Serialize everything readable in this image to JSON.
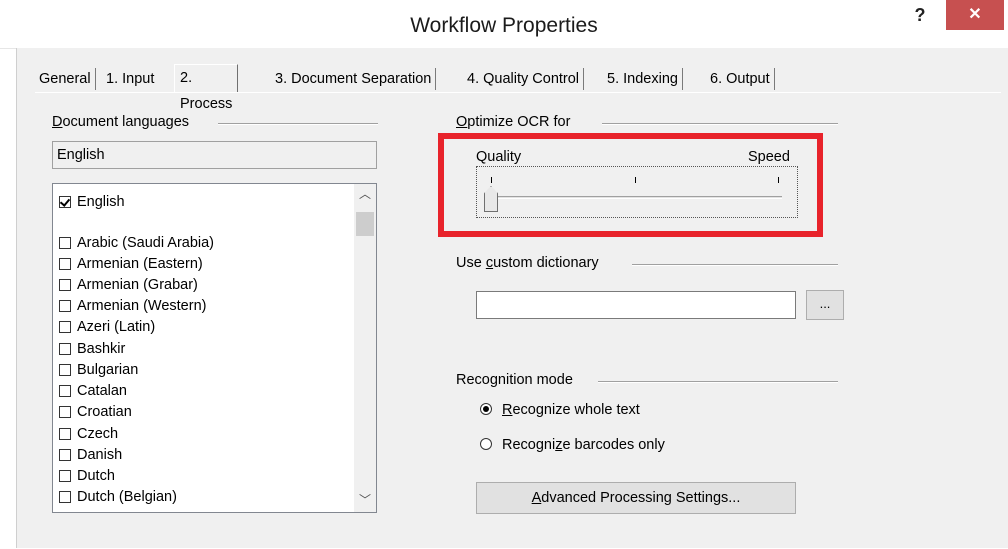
{
  "window": {
    "title": "Workflow Properties",
    "help_label": "?",
    "close_label": "✕"
  },
  "tabs": [
    {
      "label": "General"
    },
    {
      "label": "1. Input"
    },
    {
      "label": "2. Process",
      "active": true
    },
    {
      "label": "3. Document Separation"
    },
    {
      "label": "4. Quality Control"
    },
    {
      "label": "5. Indexing"
    },
    {
      "label": "6. Output"
    }
  ],
  "languages": {
    "heading_first": "D",
    "heading_rest": "ocument languages",
    "selected_summary": "English",
    "checked_items": [
      {
        "label": "English",
        "checked": true
      }
    ],
    "items": [
      {
        "label": "Arabic (Saudi Arabia)",
        "checked": false
      },
      {
        "label": "Armenian (Eastern)",
        "checked": false
      },
      {
        "label": "Armenian (Grabar)",
        "checked": false
      },
      {
        "label": "Armenian (Western)",
        "checked": false
      },
      {
        "label": "Azeri (Latin)",
        "checked": false
      },
      {
        "label": "Bashkir",
        "checked": false
      },
      {
        "label": "Bulgarian",
        "checked": false
      },
      {
        "label": "Catalan",
        "checked": false
      },
      {
        "label": "Croatian",
        "checked": false
      },
      {
        "label": "Czech",
        "checked": false
      },
      {
        "label": "Danish",
        "checked": false
      },
      {
        "label": "Dutch",
        "checked": false
      },
      {
        "label": "Dutch (Belgian)",
        "checked": false
      }
    ]
  },
  "ocr": {
    "heading_pre": "",
    "heading_under": "O",
    "heading_post": "ptimize OCR for",
    "left_label": "Quality",
    "right_label": "Speed",
    "slider_position": 0,
    "slider_steps": 3
  },
  "dictionary": {
    "heading_pre": "Use ",
    "heading_under": "c",
    "heading_post": "ustom dictionary",
    "value": "",
    "browse_label": "..."
  },
  "recognition": {
    "heading": "Recognition mode",
    "options": [
      {
        "pre": "",
        "under": "R",
        "post": "ecognize whole text",
        "selected": true
      },
      {
        "pre": "Recogni",
        "under": "z",
        "post": "e barcodes only",
        "selected": false
      }
    ]
  },
  "advanced_button": {
    "pre": "",
    "under": "A",
    "post": "dvanced Processing Settings..."
  }
}
